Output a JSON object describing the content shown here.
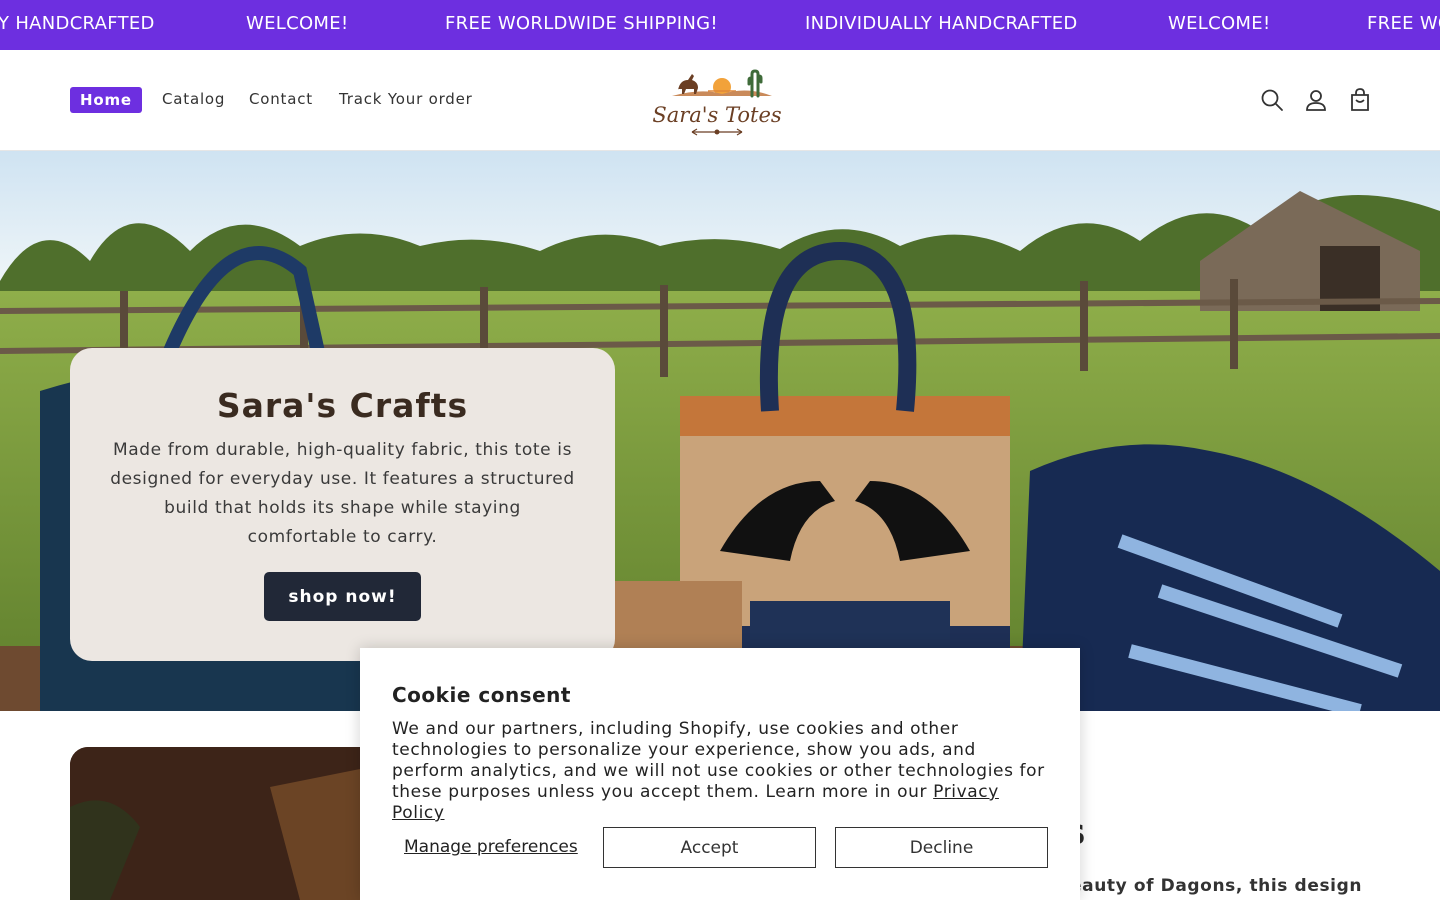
{
  "announcement": {
    "items": [
      "Y HANDCRAFTED",
      "WELCOME!",
      "FREE WORLDWIDE SHIPPING!",
      "INDIVIDUALLY HANDCRAFTED",
      "WELCOME!",
      "FREE WO"
    ]
  },
  "nav": {
    "home": "Home",
    "catalog": "Catalog",
    "contact": "Contact",
    "track": "Track Your order"
  },
  "logo": {
    "text": "Sara's Totes"
  },
  "header_icons": [
    "search-icon",
    "account-icon",
    "cart-icon"
  ],
  "hero": {
    "title": "Sara's Crafts",
    "description": "Made from durable, high-quality fabric, this tote is designed for everyday use. It features a structured build that holds its shape while staying comfortable to carry.",
    "button": "shop now!"
  },
  "feature": {
    "heading_fragment": "s",
    "text_fragment": "eauty of Dagons, this design"
  },
  "cookie": {
    "title": "Cookie consent",
    "body": "We and our partners, including Shopify, use cookies and other technologies to personalize your experience, show you ads, and perform analytics, and we will not use cookies or other technologies for these purposes unless you accept them. Learn more in our ",
    "link": "Privacy Policy",
    "manage": "Manage preferences",
    "accept": "Accept",
    "decline": "Decline"
  },
  "colors": {
    "accent": "#6d2fe0",
    "button_dark": "#212837",
    "hero_card": "#ece7e2"
  }
}
